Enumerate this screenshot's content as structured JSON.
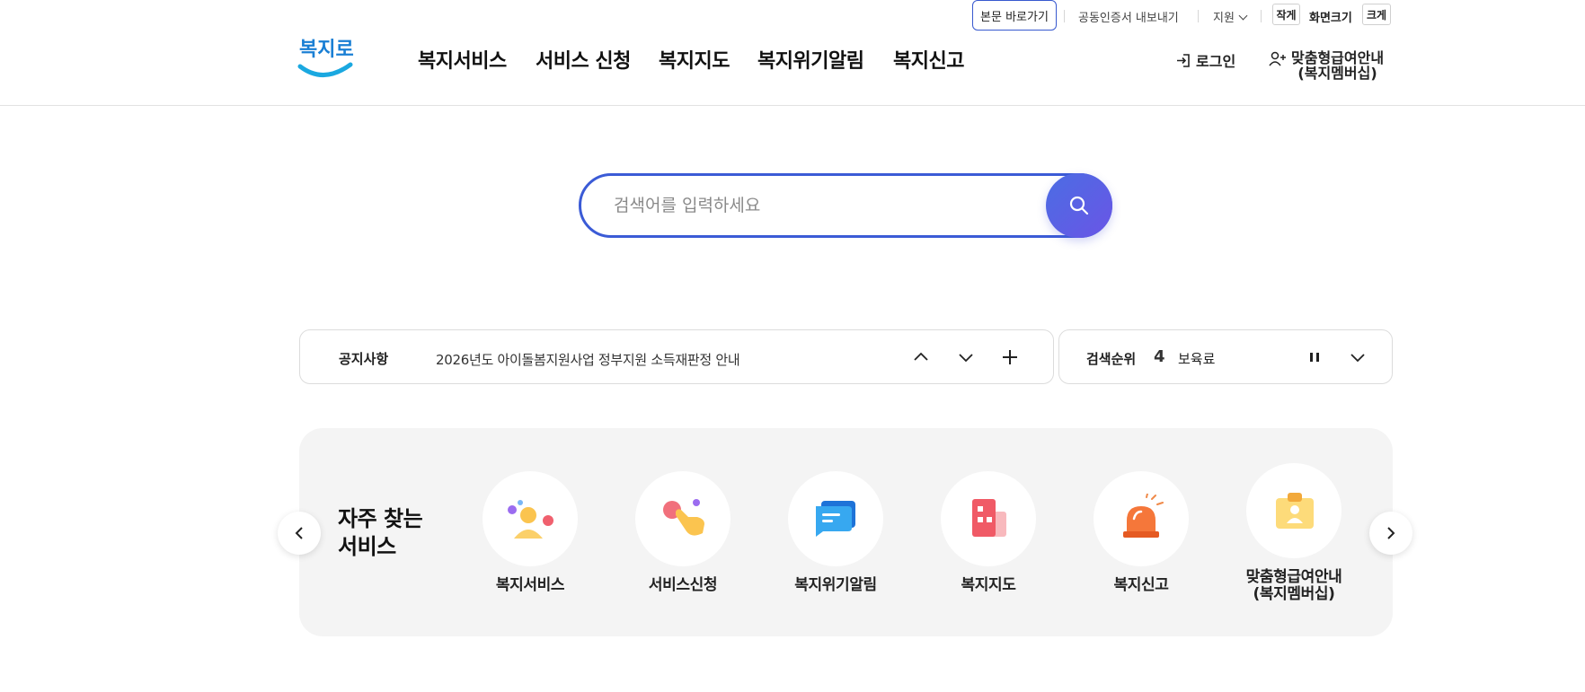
{
  "util": {
    "skip_link": "본문 바로가기",
    "cert_export": "공동인증서 내보내기",
    "support": "지원",
    "size_small": "작게",
    "font_size": "화면크기",
    "size_large": "크게"
  },
  "header": {
    "logo_text": "복지로",
    "gnb": [
      "복지서비스",
      "서비스 신청",
      "복지지도",
      "복지위기알림",
      "복지신고"
    ],
    "login": "로그인",
    "membership_line1": "맞춤형급여안내",
    "membership_line2": "(복지멤버십)"
  },
  "search": {
    "placeholder": "검색어를 입력하세요"
  },
  "notice": {
    "label": "공지사항",
    "text": "2026년도 아이돌봄지원사업 정부지원 소득재판정 안내"
  },
  "ranking": {
    "label": "검색순위",
    "number": "4",
    "keyword": "보육료"
  },
  "frequent": {
    "title_line1": "자주 찾는",
    "title_line2": "서비스",
    "items": [
      {
        "label": "복지서비스"
      },
      {
        "label": "서비스신청"
      },
      {
        "label": "복지위기알림"
      },
      {
        "label": "복지지도"
      },
      {
        "label": "복지신고"
      },
      {
        "label": "맞춤형급여안내\n(복지멤버십)"
      }
    ]
  },
  "colors": {
    "accent": "#3b5bd6",
    "search_gradient_start": "#4b6de3",
    "search_gradient_end": "#6a55e6",
    "panel_bg": "#f4f4f4"
  }
}
